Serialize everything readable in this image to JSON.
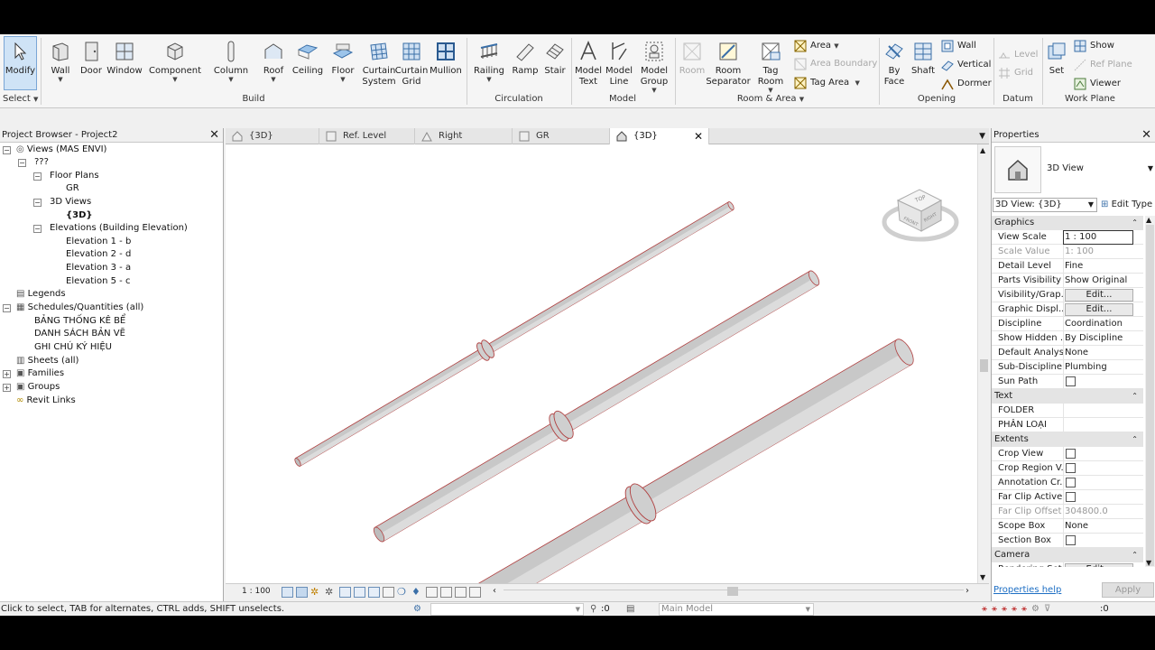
{
  "ribbon": {
    "select_button": "Modify",
    "select_label": "Select",
    "build": {
      "label": "Build",
      "wall": "Wall",
      "door": "Door",
      "window": "Window",
      "component": "Component",
      "column": "Column",
      "roof": "Roof",
      "ceiling": "Ceiling",
      "floor": "Floor",
      "curtain_system": [
        "Curtain",
        "System"
      ],
      "curtain_grid": [
        "Curtain",
        "Grid"
      ],
      "mullion": "Mullion"
    },
    "circulation": {
      "label": "Circulation",
      "railing": "Railing",
      "ramp": "Ramp",
      "stair": "Stair"
    },
    "model": {
      "label": "Model",
      "model_text": [
        "Model",
        "Text"
      ],
      "model_line": [
        "Model",
        "Line"
      ],
      "model_group": [
        "Model",
        "Group"
      ]
    },
    "room_area": {
      "label": "Room & Area",
      "room": "Room",
      "room_separator": [
        "Room",
        "Separator"
      ],
      "tag_room": [
        "Tag",
        "Room"
      ],
      "area": "Area",
      "area_boundary": "Area  Boundary",
      "tag_area": "Tag  Area"
    },
    "opening": {
      "label": "Opening",
      "by_face": [
        "By",
        "Face"
      ],
      "shaft": "Shaft",
      "wall": "Wall",
      "vertical": "Vertical",
      "dormer": "Dormer"
    },
    "datum": {
      "label": "Datum",
      "level": "Level",
      "grid": "Grid"
    },
    "work_plane": {
      "label": "Work Plane",
      "set": "Set",
      "show": "Show",
      "ref_plane": "Ref  Plane",
      "viewer": "Viewer"
    }
  },
  "project_browser": {
    "title": "Project Browser - Project2",
    "items": {
      "views": "Views (MAS ENVI)",
      "unknown": "???",
      "floor_plans": "Floor Plans",
      "gr": "GR",
      "views_3d": "3D Views",
      "view_3d": "{3D}",
      "elevations": "Elevations (Building Elevation)",
      "elev1": "Elevation 1 - b",
      "elev2": "Elevation 2 - d",
      "elev3": "Elevation 3 - a",
      "elev5": "Elevation 5 - c",
      "legends": "Legends",
      "schedules": "Schedules/Quantities (all)",
      "sched1": "BẢNG THỐNG KÊ BỂ",
      "sched2": "DANH SÁCH BẢN VẼ",
      "sched3": "GHI CHÚ KÝ HIỆU",
      "sheets": "Sheets (all)",
      "families": "Families",
      "groups": "Groups",
      "revit_links": "Revit Links"
    }
  },
  "tabs": [
    "{3D}",
    "Ref. Level",
    "Right",
    "GR",
    "{3D}"
  ],
  "viewport": {
    "scale": "1 : 100",
    "viewcube": {
      "top": "TOP",
      "front": "FRONT",
      "right": "RIGHT"
    }
  },
  "properties": {
    "title": "Properties",
    "type_name": "3D View",
    "selector": "3D View: {3D}",
    "edit_type": "Edit Type",
    "groups": {
      "graphics": "Graphics",
      "text": "Text",
      "extents": "Extents",
      "camera": "Camera"
    },
    "graphics_rows": [
      {
        "k": "View Scale",
        "v": "1 : 100"
      },
      {
        "k": "Scale Value",
        "v": "1:  100"
      },
      {
        "k": "Detail Level",
        "v": "Fine"
      },
      {
        "k": "Parts Visibility",
        "v": "Show Original"
      },
      {
        "k": "Visibility/Grap...",
        "v": "Edit..."
      },
      {
        "k": "Graphic Displ...",
        "v": "Edit..."
      },
      {
        "k": "Discipline",
        "v": "Coordination"
      },
      {
        "k": "Show Hidden ...",
        "v": "By Discipline"
      },
      {
        "k": "Default Analys...",
        "v": "None"
      },
      {
        "k": "Sub-Discipline",
        "v": "Plumbing"
      },
      {
        "k": "Sun Path",
        "v": ""
      }
    ],
    "text_rows": [
      {
        "k": "FOLDER",
        "v": ""
      },
      {
        "k": "PHÂN LOẠI",
        "v": ""
      }
    ],
    "extents_rows": [
      {
        "k": "Crop View",
        "v": ""
      },
      {
        "k": "Crop Region V...",
        "v": ""
      },
      {
        "k": "Annotation Cr...",
        "v": ""
      },
      {
        "k": "Far Clip Active",
        "v": ""
      },
      {
        "k": "Far Clip Offset",
        "v": "304800.0"
      },
      {
        "k": "Scope Box",
        "v": "None"
      },
      {
        "k": "Section Box",
        "v": ""
      }
    ],
    "camera_rows": [
      {
        "k": "Rendering Set...",
        "v": "Edit..."
      }
    ],
    "help": "Properties help",
    "apply": "Apply"
  },
  "status": {
    "message": "Click to select, TAB for alternates, CTRL adds, SHIFT unselects.",
    "selection_count": ":0",
    "model": "Main Model",
    "filter_count": ":0"
  },
  "colors": {
    "accent": "#1e6fc4",
    "pipe_edge": "#b04040",
    "pipe_fill": "#c8c8c8"
  }
}
